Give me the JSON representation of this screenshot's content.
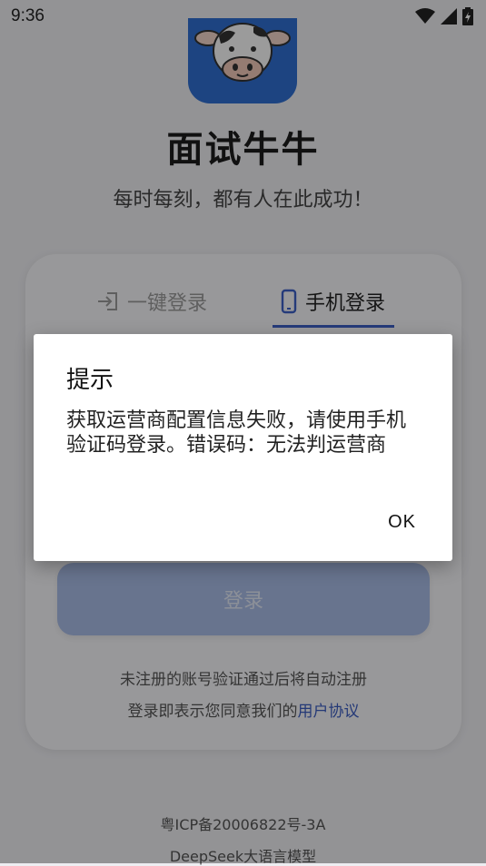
{
  "status_bar": {
    "time": "9:36"
  },
  "app": {
    "title": "面试牛牛",
    "slogan": "每时每刻，都有人在此成功！"
  },
  "login": {
    "tabs": [
      {
        "label": "一键登录"
      },
      {
        "label": "手机登录"
      }
    ],
    "login_button": "登录",
    "notice_line1": "未注册的账号验证通过后将自动注册",
    "notice_line2_prefix": "登录即表示您同意我们的",
    "agreement_link": "用户协议"
  },
  "footer": {
    "icp": "粤ICP备20006822号-3A",
    "model": "DeepSeek大语言模型"
  },
  "dialog": {
    "title": "提示",
    "message": "获取运营商配置信息失败，请使用手机验证码登录。错误码：无法判运营商",
    "ok_label": "OK"
  },
  "colors": {
    "accent": "#3c5fc6",
    "logo_bg": "#2f6fd1",
    "button_bg": "#a9bbe6"
  }
}
